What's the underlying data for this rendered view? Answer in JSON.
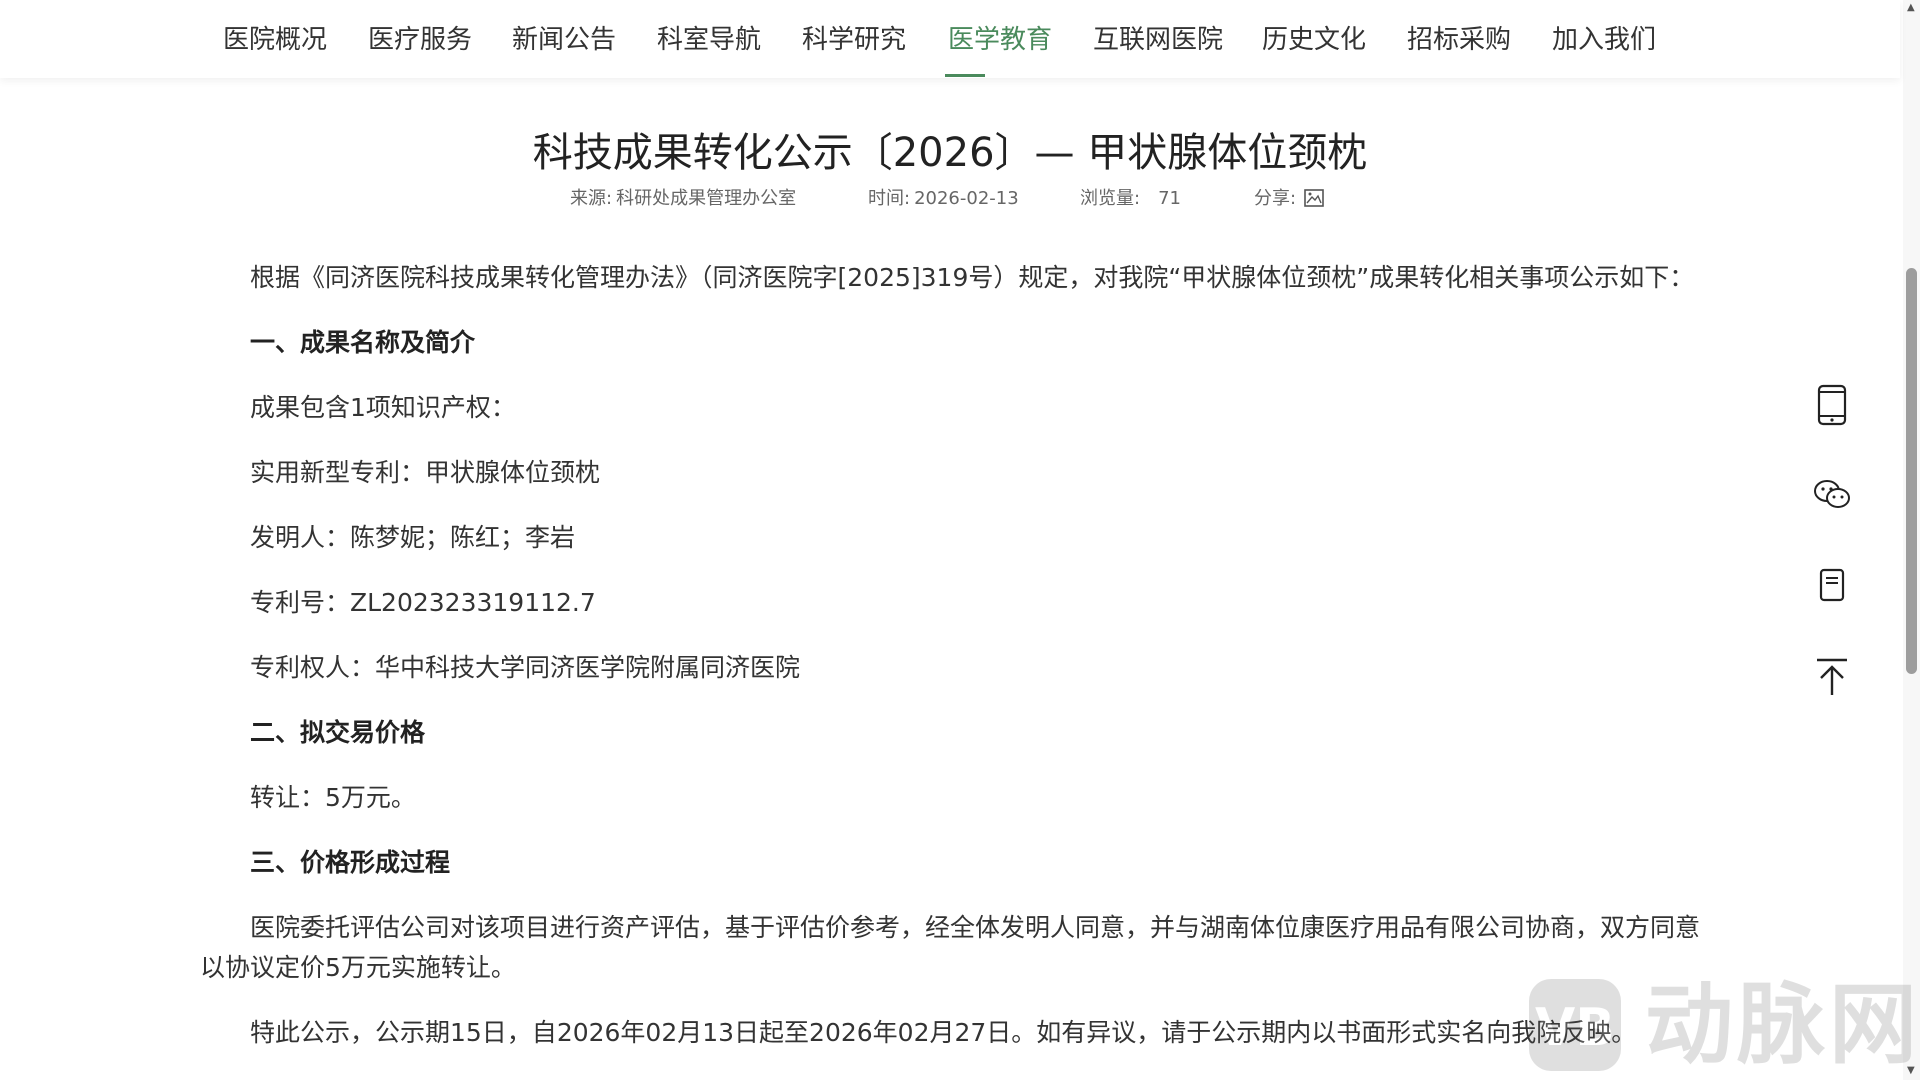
{
  "nav": {
    "items": [
      {
        "label": "医院概况"
      },
      {
        "label": "医疗服务"
      },
      {
        "label": "新闻公告"
      },
      {
        "label": "科室导航"
      },
      {
        "label": "科学研究"
      },
      {
        "label": "医学教育",
        "active": true
      },
      {
        "label": "互联网医院"
      },
      {
        "label": "历史文化"
      },
      {
        "label": "招标采购"
      },
      {
        "label": "加入我们"
      }
    ],
    "active_color": "#4a8a5c"
  },
  "article": {
    "title": "科技成果转化公示〔2026〕— 甲状腺体位颈枕",
    "meta": {
      "source_label": "来源:",
      "source_value": "科研处成果管理办公室",
      "time_label": "时间:",
      "time_value": "2026-02-13",
      "views_label": "浏览量:",
      "views_value": "71",
      "share_label": "分享:"
    },
    "paragraphs": [
      "根据《同济医院科技成果转化管理办法》（同济医院字[2025]319号）规定，对我院“甲状腺体位颈枕”成果转化相关事项公示如下：",
      "一、成果名称及简介",
      "成果包含1项知识产权：",
      "实用新型专利：甲状腺体位颈枕",
      "发明人：陈梦妮；陈红；李岩",
      "专利号：ZL202323319112.7",
      "专利权人：华中科技大学同济医学院附属同济医院",
      "二、拟交易价格",
      "转让：5万元。",
      "三、价格形成过程",
      "医院委托评估公司对该项目进行资产评估，基于评估价参考，经全体发明人同意，并与湖南体位康医疗用品有限公司协商，双方同意以协议定价5万元实施转让。",
      "特此公示，公示期15日，自2026年02月13日起至2026年02月27日。如有异议，请于公示期内以书面形式实名向我院反映。"
    ]
  },
  "tools": [
    "phone-icon",
    "wechat-icon",
    "bookmark-icon",
    "back-to-top-icon"
  ],
  "watermark": {
    "text": "动脉网",
    "icon": "logo-icon"
  }
}
